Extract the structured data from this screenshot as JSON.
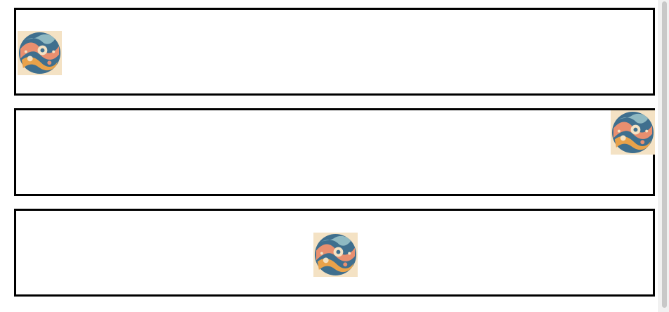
{
  "boxes": [
    {
      "image": {
        "alt": "abstract-circle-art",
        "alignment": "left"
      }
    },
    {
      "image": {
        "alt": "abstract-circle-art",
        "alignment": "top-right"
      }
    },
    {
      "image": {
        "alt": "abstract-circle-art",
        "alignment": "center"
      }
    }
  ],
  "colors": {
    "border": "#000000",
    "background": "#ffffff",
    "art_cream": "#f4e2c4",
    "art_blue": "#3f6f8e",
    "art_coral": "#e98f6f",
    "art_orange": "#e9a24a",
    "art_teal": "#8fb9c2",
    "scrollbar_track": "#f1f1f1",
    "scrollbar_thumb": "#c8c8c8"
  }
}
